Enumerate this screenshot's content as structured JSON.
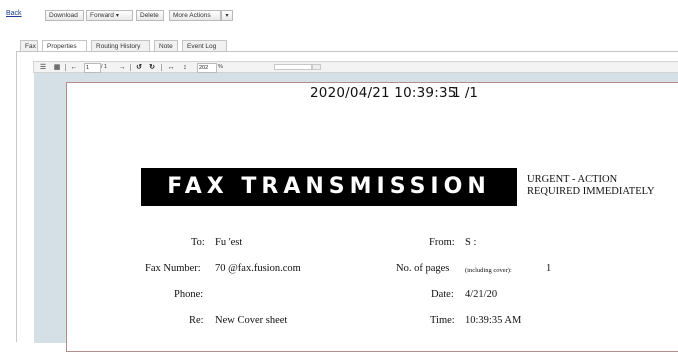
{
  "actions": {
    "back": "Back",
    "download": "Download",
    "forward": "Forward",
    "delete": "Delete",
    "more_actions": "More Actions"
  },
  "tabs": [
    "Fax",
    "Properties",
    "Routing History",
    "Note",
    "Event Log"
  ],
  "viewer": {
    "current_page": "1",
    "page_total": "/ 1",
    "zoom": "202",
    "zoom_unit": "%"
  },
  "document": {
    "header_datetime": "2020/04/21 10:39:35",
    "header_pages": "1   /1",
    "banner": "FAX TRANSMISSION",
    "urgent_line1": "URGENT - ACTION",
    "urgent_line2": "REQUIRED IMMEDIATELY",
    "to_label": "To:",
    "to_value": "Fu           'est",
    "from_label": "From:",
    "from_value": "S              :",
    "fax_label": "Fax Number:",
    "fax_value": "70            @fax.fusion.com",
    "pages_label": "No. of pages",
    "pages_note": "(including cover):",
    "pages_value": "1",
    "phone_label": "Phone:",
    "date_label": "Date:",
    "date_value": "4/21/20",
    "re_label": "Re:",
    "re_value": "New Cover sheet",
    "time_label": "Time:",
    "time_value": "10:39:35 AM"
  }
}
